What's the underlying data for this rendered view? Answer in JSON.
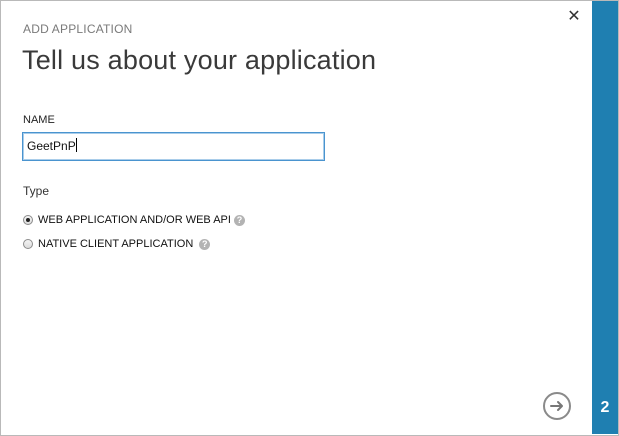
{
  "dialog": {
    "supertitle": "ADD APPLICATION",
    "title": "Tell us about your application",
    "close_icon": "close-icon",
    "step": "2"
  },
  "form": {
    "name_label": "NAME",
    "name_value": "GeetPnP",
    "type_label": "Type",
    "options": [
      {
        "label": "WEB APPLICATION AND/OR WEB API",
        "selected": true,
        "help_icon": "help-icon"
      },
      {
        "label": "NATIVE CLIENT APPLICATION",
        "selected": false,
        "help_icon": "help-icon"
      }
    ]
  },
  "navigation": {
    "next_icon": "arrow-right-icon"
  },
  "colors": {
    "accent": "#1f7fb1",
    "input_border": "#4a94cf"
  }
}
